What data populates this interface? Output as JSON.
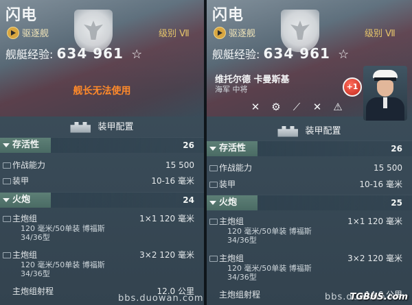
{
  "ship": {
    "name": "闪电",
    "class_label": "驱逐舰",
    "tier_label": "级别 Ⅶ",
    "exp_label": "舰艇经验:",
    "exp_value": "634  961",
    "star": "☆"
  },
  "left": {
    "captain_status": "舰长无法使用"
  },
  "right": {
    "captain_name": "维托尔德  卡曼斯基",
    "captain_rank": "海军 中将",
    "skill_points_badge": "+1",
    "skill_icons": [
      "torpedo-skill-icon",
      "turret-skill-icon",
      "reload-skill-icon",
      "aa-skill-icon",
      "warning-skill-icon"
    ]
  },
  "armor_config_label": "装甲配置",
  "survivability": {
    "label": "存活性",
    "score": "26",
    "rows": [
      {
        "label": "作战能力",
        "value": "15  500"
      },
      {
        "label": "装甲",
        "value": "10-16 毫米"
      }
    ]
  },
  "artillery": {
    "label": "火炮",
    "score_left": "24",
    "score_right": "25",
    "rows": [
      {
        "label": "主炮组",
        "value": "1×1  120  毫米",
        "sub1": "120  毫米/50单装  博福斯",
        "sub2": "34/36型"
      },
      {
        "label": "主炮组",
        "value": "3×2  120  毫米",
        "sub1": "120  毫米/50单装  博福斯",
        "sub2": "34/36型"
      }
    ],
    "range_label": "主炮组射程",
    "range_value_left": "12.0 公里",
    "range_value_right": "14.6 公里"
  },
  "watermark": "bbs.duowan.com",
  "watermark_right": "bbs.duowan",
  "tgbus": "TGBUS.com"
}
